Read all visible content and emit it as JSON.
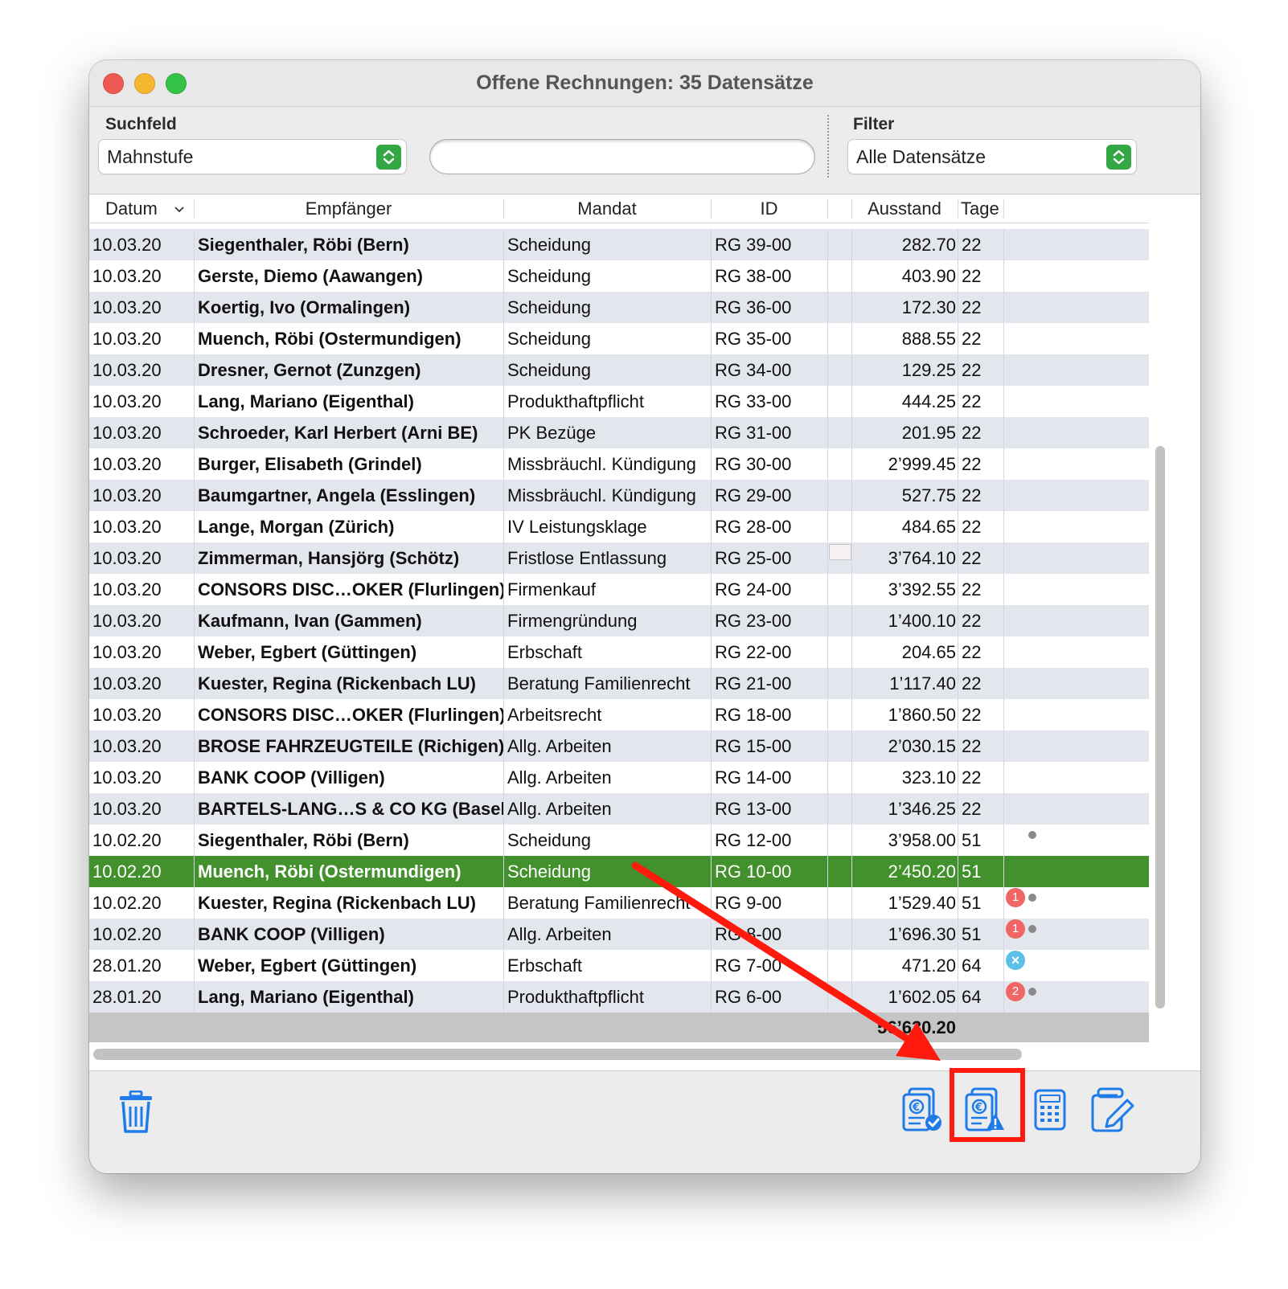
{
  "window": {
    "title": "Offene Rechnungen: 35 Datensätze"
  },
  "search": {
    "label": "Suchfeld",
    "field_value": "Mahnstufe",
    "query": ""
  },
  "filter": {
    "label": "Filter",
    "value": "Alle Datensätze"
  },
  "columns": {
    "datum": "Datum",
    "empfaenger": "Empfänger",
    "mandat": "Mandat",
    "id": "ID",
    "ausstand": "Ausstand",
    "tage": "Tage"
  },
  "rows": [
    {
      "datum": "10.03.20",
      "empfaenger": "Siegenthaler, Röbi (Bern)",
      "mandat": "Scheidung",
      "id": "RG 39-00",
      "ausstand": "282.70",
      "tage": "22"
    },
    {
      "datum": "10.03.20",
      "empfaenger": "Gerste, Diemo (Aawangen)",
      "mandat": "Scheidung",
      "id": "RG 38-00",
      "ausstand": "403.90",
      "tage": "22"
    },
    {
      "datum": "10.03.20",
      "empfaenger": "Koertig, Ivo (Ormalingen)",
      "mandat": "Scheidung",
      "id": "RG 36-00",
      "ausstand": "172.30",
      "tage": "22"
    },
    {
      "datum": "10.03.20",
      "empfaenger": "Muench, Röbi (Ostermundigen)",
      "mandat": "Scheidung",
      "id": "RG 35-00",
      "ausstand": "888.55",
      "tage": "22"
    },
    {
      "datum": "10.03.20",
      "empfaenger": "Dresner, Gernot (Zunzgen)",
      "mandat": "Scheidung",
      "id": "RG 34-00",
      "ausstand": "129.25",
      "tage": "22"
    },
    {
      "datum": "10.03.20",
      "empfaenger": "Lang, Mariano (Eigenthal)",
      "mandat": "Produkthaftpflicht",
      "id": "RG 33-00",
      "ausstand": "444.25",
      "tage": "22"
    },
    {
      "datum": "10.03.20",
      "empfaenger": "Schroeder, Karl Herbert (Arni BE)",
      "mandat": "PK Bezüge",
      "id": "RG 31-00",
      "ausstand": "201.95",
      "tage": "22"
    },
    {
      "datum": "10.03.20",
      "empfaenger": "Burger, Elisabeth (Grindel)",
      "mandat": "Missbräuchl. Kündigung",
      "id": "RG 30-00",
      "ausstand": "2’999.45",
      "tage": "22"
    },
    {
      "datum": "10.03.20",
      "empfaenger": "Baumgartner, Angela (Esslingen)",
      "mandat": "Missbräuchl. Kündigung",
      "id": "RG 29-00",
      "ausstand": "527.75",
      "tage": "22"
    },
    {
      "datum": "10.03.20",
      "empfaenger": "Lange, Morgan (Zürich)",
      "mandat": "IV Leistungsklage",
      "id": "RG 28-00",
      "ausstand": "484.65",
      "tage": "22"
    },
    {
      "datum": "10.03.20",
      "empfaenger": "Zimmerman, Hansjörg (Schötz)",
      "mandat": "Fristlose Entlassung",
      "id": "RG 25-00",
      "ausstand": "3’764.10",
      "tage": "22",
      "mail": true
    },
    {
      "datum": "10.03.20",
      "empfaenger": "CONSORS DISC…OKER (Flurlingen)",
      "mandat": "Firmenkauf",
      "id": "RG 24-00",
      "ausstand": "3’392.55",
      "tage": "22"
    },
    {
      "datum": "10.03.20",
      "empfaenger": "Kaufmann, Ivan (Gammen)",
      "mandat": "Firmengründung",
      "id": "RG 23-00",
      "ausstand": "1’400.10",
      "tage": "22"
    },
    {
      "datum": "10.03.20",
      "empfaenger": "Weber, Egbert (Güttingen)",
      "mandat": "Erbschaft",
      "id": "RG 22-00",
      "ausstand": "204.65",
      "tage": "22"
    },
    {
      "datum": "10.03.20",
      "empfaenger": "Kuester, Regina (Rickenbach LU)",
      "mandat": "Beratung Familienrecht",
      "id": "RG 21-00",
      "ausstand": "1’117.40",
      "tage": "22"
    },
    {
      "datum": "10.03.20",
      "empfaenger": "CONSORS DISC…OKER (Flurlingen)",
      "mandat": "Arbeitsrecht",
      "id": "RG 18-00",
      "ausstand": "1’860.50",
      "tage": "22"
    },
    {
      "datum": "10.03.20",
      "empfaenger": "BROSE FAHRZEUGTEILE (Richigen)",
      "mandat": "Allg. Arbeiten",
      "id": "RG 15-00",
      "ausstand": "2’030.15",
      "tage": "22"
    },
    {
      "datum": "10.03.20",
      "empfaenger": "BANK COOP (Villigen)",
      "mandat": "Allg. Arbeiten",
      "id": "RG 14-00",
      "ausstand": "323.10",
      "tage": "22"
    },
    {
      "datum": "10.03.20",
      "empfaenger": "BARTELS-LANG…S & CO KG (Basel)",
      "mandat": "Allg. Arbeiten",
      "id": "RG 13-00",
      "ausstand": "1’346.25",
      "tage": "22"
    },
    {
      "datum": "10.02.20",
      "empfaenger": "Siegenthaler, Röbi (Bern)",
      "mandat": "Scheidung",
      "id": "RG 12-00",
      "ausstand": "3’958.00",
      "tage": "51",
      "dot": true
    },
    {
      "datum": "10.02.20",
      "empfaenger": "Muench, Röbi (Ostermundigen)",
      "mandat": "Scheidung",
      "id": "RG 10-00",
      "ausstand": "2’450.20",
      "tage": "51",
      "selected": true
    },
    {
      "datum": "10.02.20",
      "empfaenger": "Kuester, Regina (Rickenbach LU)",
      "mandat": "Beratung Familienrecht",
      "id": "RG 9-00",
      "ausstand": "1’529.40",
      "tage": "51",
      "badge": "1",
      "dot": true
    },
    {
      "datum": "10.02.20",
      "empfaenger": "BANK COOP (Villigen)",
      "mandat": "Allg. Arbeiten",
      "id": "RG 8-00",
      "ausstand": "1’696.30",
      "tage": "51",
      "badge": "1",
      "dot": true
    },
    {
      "datum": "28.01.20",
      "empfaenger": "Weber, Egbert (Güttingen)",
      "mandat": "Erbschaft",
      "id": "RG 7-00",
      "ausstand": "471.20",
      "tage": "64",
      "cancel": true
    },
    {
      "datum": "28.01.20",
      "empfaenger": "Lang, Mariano (Eigenthal)",
      "mandat": "Produkthaftpflicht",
      "id": "RG 6-00",
      "ausstand": "1’602.05",
      "tage": "64",
      "badge": "2",
      "dot": true
    }
  ],
  "total": {
    "ausstand": "56’630.20"
  },
  "icons": {
    "delete": "trash-icon",
    "paid": "invoice-paid-icon",
    "reminder": "invoice-reminder-icon",
    "calculator": "calculator-icon",
    "edit": "edit-icon"
  },
  "colors": {
    "selection": "#42912d",
    "accent": "#1f7bea",
    "highlight": "#ff1a0d",
    "badge": "#ef6665"
  }
}
